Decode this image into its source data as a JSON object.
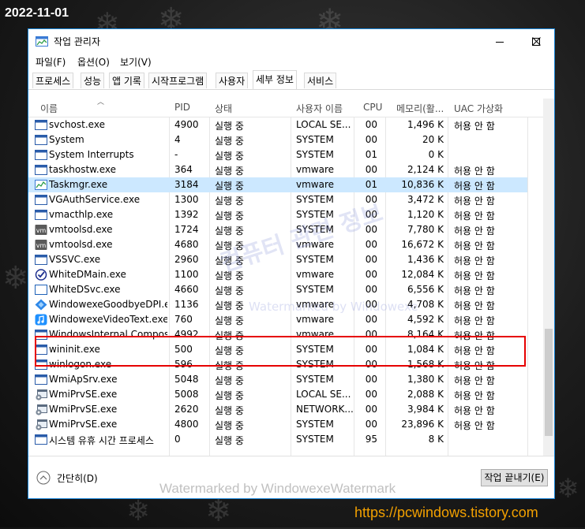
{
  "overlay": {
    "date": "2022-11-01",
    "site_url": "https://pcwindows.tistory.com"
  },
  "window": {
    "title": "작업 관리자"
  },
  "menu": [
    "파일(F)",
    "옵션(O)",
    "보기(V)"
  ],
  "tabs": [
    "프로세스",
    "성능",
    "앱 기록",
    "시작프로그램",
    "사용자",
    "세부 정보",
    "서비스"
  ],
  "active_tab": "세부 정보",
  "columns": {
    "name": "이름",
    "pid": "PID",
    "status": "상태",
    "user": "사용자 이름",
    "cpu": "CPU",
    "memory": "메모리(활...",
    "uac": "UAC 가상화"
  },
  "processes": [
    {
      "name": "svchost.exe",
      "pid": "4900",
      "status": "실행 중",
      "user": "LOCAL SE...",
      "cpu": "00",
      "memory": "1,496 K",
      "uac": "허용 안 함",
      "icon": "window-icon"
    },
    {
      "name": "System",
      "pid": "4",
      "status": "실행 중",
      "user": "SYSTEM",
      "cpu": "00",
      "memory": "20 K",
      "uac": "",
      "icon": "window-icon"
    },
    {
      "name": "System Interrupts",
      "pid": "-",
      "status": "실행 중",
      "user": "SYSTEM",
      "cpu": "01",
      "memory": "0 K",
      "uac": "",
      "icon": "window-icon"
    },
    {
      "name": "taskhostw.exe",
      "pid": "364",
      "status": "실행 중",
      "user": "vmware",
      "cpu": "00",
      "memory": "2,124 K",
      "uac": "허용 안 함",
      "icon": "window-icon"
    },
    {
      "name": "Taskmgr.exe",
      "pid": "3184",
      "status": "실행 중",
      "user": "vmware",
      "cpu": "01",
      "memory": "10,836 K",
      "uac": "허용 안 함",
      "icon": "task-manager-icon"
    },
    {
      "name": "VGAuthService.exe",
      "pid": "1300",
      "status": "실행 중",
      "user": "SYSTEM",
      "cpu": "00",
      "memory": "3,472 K",
      "uac": "허용 안 함",
      "icon": "window-icon"
    },
    {
      "name": "vmacthlp.exe",
      "pid": "1392",
      "status": "실행 중",
      "user": "SYSTEM",
      "cpu": "00",
      "memory": "1,120 K",
      "uac": "허용 안 함",
      "icon": "window-icon"
    },
    {
      "name": "vmtoolsd.exe",
      "pid": "1724",
      "status": "실행 중",
      "user": "SYSTEM",
      "cpu": "00",
      "memory": "7,780 K",
      "uac": "허용 안 함",
      "icon": "vmware-icon"
    },
    {
      "name": "vmtoolsd.exe",
      "pid": "4680",
      "status": "실행 중",
      "user": "vmware",
      "cpu": "00",
      "memory": "16,672 K",
      "uac": "허용 안 함",
      "icon": "vmware-icon"
    },
    {
      "name": "VSSVC.exe",
      "pid": "2960",
      "status": "실행 중",
      "user": "SYSTEM",
      "cpu": "00",
      "memory": "1,436 K",
      "uac": "허용 안 함",
      "icon": "window-icon"
    },
    {
      "name": "WhiteDMain.exe",
      "pid": "1100",
      "status": "실행 중",
      "user": "vmware",
      "cpu": "00",
      "memory": "12,084 K",
      "uac": "허용 안 함",
      "icon": "check-circle-icon"
    },
    {
      "name": "WhiteDSvc.exe",
      "pid": "4660",
      "status": "실행 중",
      "user": "SYSTEM",
      "cpu": "00",
      "memory": "6,556 K",
      "uac": "허용 안 함",
      "icon": "blank-window-icon"
    },
    {
      "name": "WindowexeGoodbyeDPI.exe",
      "pid": "1136",
      "status": "실행 중",
      "user": "vmware",
      "cpu": "00",
      "memory": "4,708 K",
      "uac": "허용 안 함",
      "icon": "blue-diamond-icon"
    },
    {
      "name": "WindowexeVideoText.exe",
      "pid": "760",
      "status": "실행 중",
      "user": "vmware",
      "cpu": "00",
      "memory": "4,592 K",
      "uac": "허용 안 함",
      "icon": "music-note-icon"
    },
    {
      "name": "WindowsInternal.Compos...",
      "pid": "4992",
      "status": "실행 중",
      "user": "vmware",
      "cpu": "00",
      "memory": "8,164 K",
      "uac": "허용 안 함",
      "icon": "window-icon"
    },
    {
      "name": "wininit.exe",
      "pid": "500",
      "status": "실행 중",
      "user": "SYSTEM",
      "cpu": "00",
      "memory": "1,084 K",
      "uac": "허용 안 함",
      "icon": "window-icon"
    },
    {
      "name": "winlogon.exe",
      "pid": "596",
      "status": "실행 중",
      "user": "SYSTEM",
      "cpu": "00",
      "memory": "1,568 K",
      "uac": "허용 안 함",
      "icon": "window-icon"
    },
    {
      "name": "WmiApSrv.exe",
      "pid": "5048",
      "status": "실행 중",
      "user": "SYSTEM",
      "cpu": "00",
      "memory": "1,380 K",
      "uac": "허용 안 함",
      "icon": "window-icon"
    },
    {
      "name": "WmiPrvSE.exe",
      "pid": "5008",
      "status": "실행 중",
      "user": "LOCAL SE...",
      "cpu": "00",
      "memory": "2,088 K",
      "uac": "허용 안 함",
      "icon": "gear-window-icon"
    },
    {
      "name": "WmiPrvSE.exe",
      "pid": "2620",
      "status": "실행 중",
      "user": "NETWORK...",
      "cpu": "00",
      "memory": "3,984 K",
      "uac": "허용 안 함",
      "icon": "gear-window-icon"
    },
    {
      "name": "WmiPrvSE.exe",
      "pid": "4800",
      "status": "실행 중",
      "user": "SYSTEM",
      "cpu": "00",
      "memory": "23,896 K",
      "uac": "허용 안 함",
      "icon": "gear-window-icon"
    },
    {
      "name": "시스템 유휴 시간 프로세스",
      "pid": "0",
      "status": "실행 중",
      "user": "SYSTEM",
      "cpu": "95",
      "memory": "8 K",
      "uac": "",
      "icon": "window-icon"
    }
  ],
  "selected_row": "Taskmgr.exe",
  "highlighted_rows": [
    "WhiteDMain.exe",
    "WhiteDSvc.exe"
  ],
  "footer": {
    "fewer_details": "간단히(D)",
    "end_task": "작업 끝내기(E)"
  },
  "watermarks": {
    "diagonal": "컴퓨터 관련 정보",
    "small": "Watermarked by Windowexe",
    "footer": "Watermarked by WindowexeWatermark"
  },
  "colors": {
    "accent": "#1783d6",
    "selected_row": "#cce8ff",
    "highlight_box": "#e60000",
    "url": "#f2a000"
  }
}
